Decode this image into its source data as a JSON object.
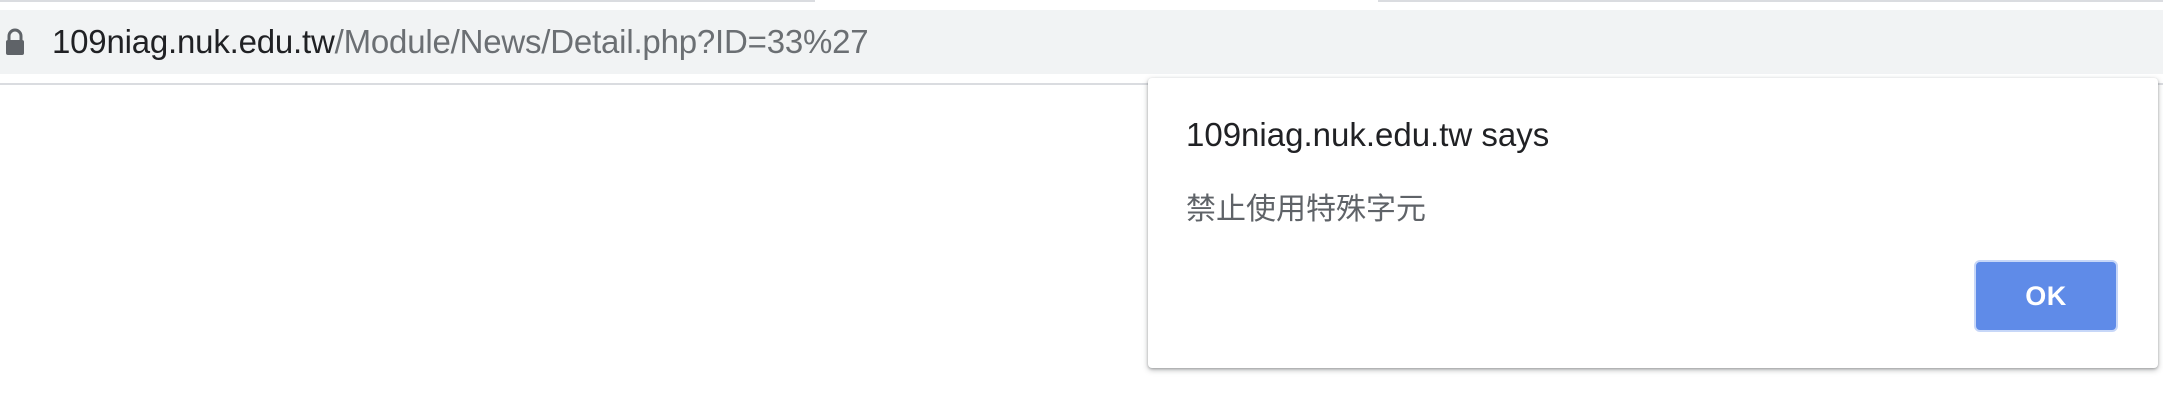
{
  "omnibox": {
    "lock_icon": "lock-icon",
    "url_host": "109niag.nuk.edu.tw",
    "url_path": "/Module/News/Detail.php?ID=33%27"
  },
  "dialog": {
    "title": "109niag.nuk.edu.tw says",
    "message": "禁止使用特殊字元",
    "ok_label": "OK"
  },
  "colors": {
    "omnibox_bg": "#f1f3f4",
    "host_text": "#202124",
    "path_text": "#6b6f73",
    "ok_button": "#5f8be8"
  }
}
